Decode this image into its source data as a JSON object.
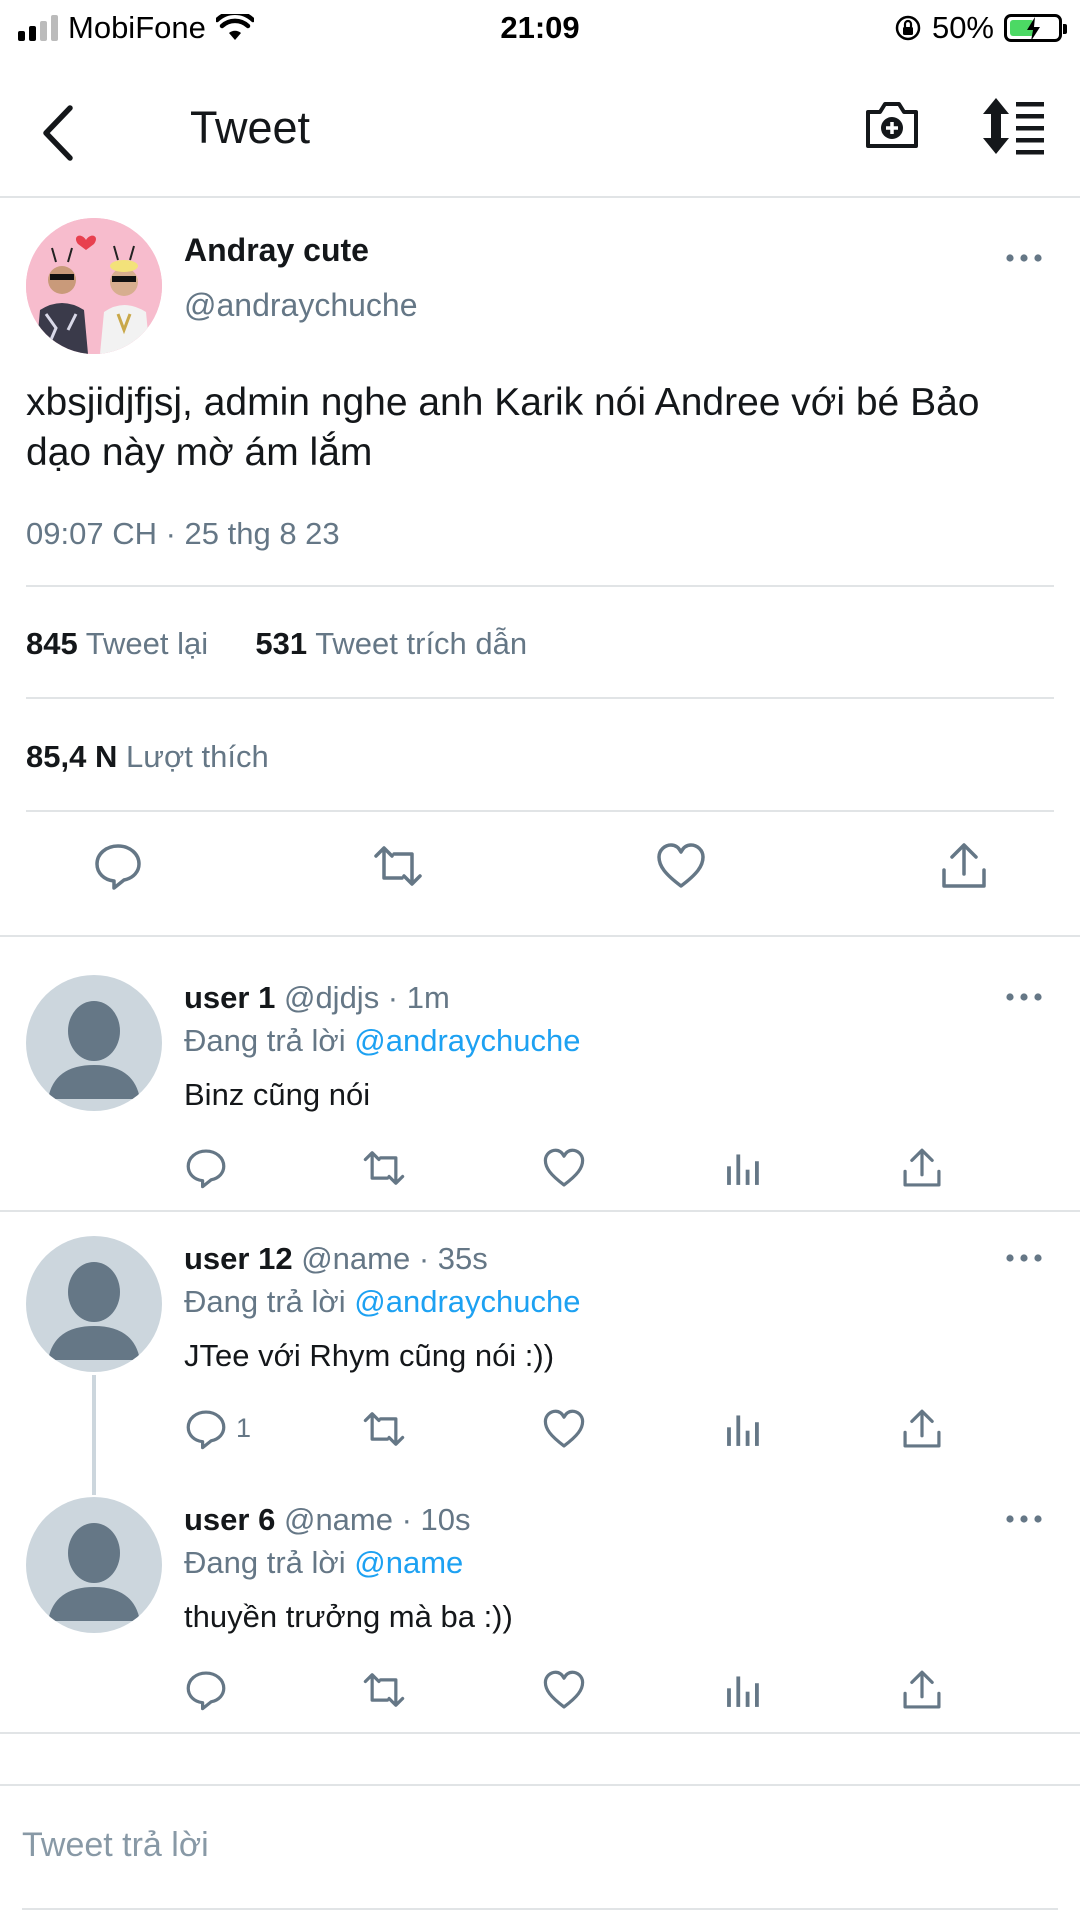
{
  "status_bar": {
    "carrier": "MobiFone",
    "time": "21:09",
    "battery": "50%"
  },
  "header": {
    "title": "Tweet"
  },
  "tweet": {
    "author_name": "Andray cute",
    "author_handle": "@andraychuche",
    "text": "xbsjidjfjsj, admin nghe anh Karik nói Andree với bé Bảo dạo này mờ ám lắm",
    "timestamp": "09:07 CH · 25 thg 8 23",
    "retweets_count": "845",
    "retweets_label": "Tweet lại",
    "quotes_count": "531",
    "quotes_label": "Tweet trích dẫn",
    "likes_count": "85,4 N",
    "likes_label": "Lượt thích"
  },
  "replies": [
    {
      "name": "user 1",
      "meta": "@djdjs · 1m",
      "replying_prefix": "Đang trả lời",
      "replying_to": "@andraychuche",
      "text": "Binz cũng nói",
      "reply_count": ""
    },
    {
      "name": "user 12",
      "meta": "@name · 35s",
      "replying_prefix": "Đang trả lời",
      "replying_to": "@andraychuche",
      "text": "JTee với Rhym cũng nói :))",
      "reply_count": "1"
    },
    {
      "name": "user 6",
      "meta": "@name · 10s",
      "replying_prefix": "Đang trả lời",
      "replying_to": "@name",
      "text": "thuyền trưởng mà ba :))",
      "reply_count": ""
    }
  ],
  "composer": {
    "placeholder": "Tweet trả lời"
  },
  "colors": {
    "accent": "#1da1f2",
    "muted": "#657786",
    "text": "#14171a",
    "divider": "#e1e4e6",
    "battery": "#4cd964"
  }
}
